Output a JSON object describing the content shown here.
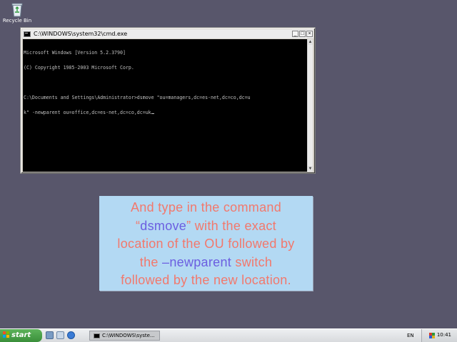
{
  "desktop": {
    "icons": [
      {
        "label": "Recycle Bin",
        "icon": "recycle-bin-icon"
      }
    ]
  },
  "cmd_window": {
    "title": "C:\\WINDOWS\\system32\\cmd.exe",
    "controls": {
      "minimize": "_",
      "maximize": "□",
      "close": "×"
    },
    "console_lines": [
      "Microsoft Windows [Version 5.2.3790]",
      "(C) Copyright 1985-2003 Microsoft Corp.",
      "",
      "C:\\Documents and Settings\\Administrator>dsmove \"ou=managers,dc=es-net,dc=co,dc=u",
      "k\" -newparent ou=office,dc=es-net,dc=co,dc=uk"
    ],
    "scroll_up": "▲",
    "scroll_down": "▼"
  },
  "caption": {
    "line1": "And type in the command",
    "line2_open": "“",
    "line2_kw": "dsmove",
    "line2_rest": "” with the exact",
    "line3": "location of the OU followed by",
    "line4_pre": "the ",
    "line4_kw": "–newparent",
    "line4_rest": " switch",
    "line5": "followed by the new location.",
    "text_color": "#f2786c",
    "keyword_color": "#6b5ee0",
    "background": "#b3d9f3"
  },
  "taskbar": {
    "start_label": "start",
    "quick_launch": [
      "show-desktop-icon",
      "explorer-icon",
      "internet-explorer-icon"
    ],
    "task_button_label": "C:\\WINDOWS\\syste...",
    "language": "EN",
    "clock": "10:41"
  },
  "colors": {
    "desktop": "#58566b",
    "console_bg": "#000000",
    "console_text": "#c0c0c0",
    "start_green": "#3a8f3a"
  }
}
